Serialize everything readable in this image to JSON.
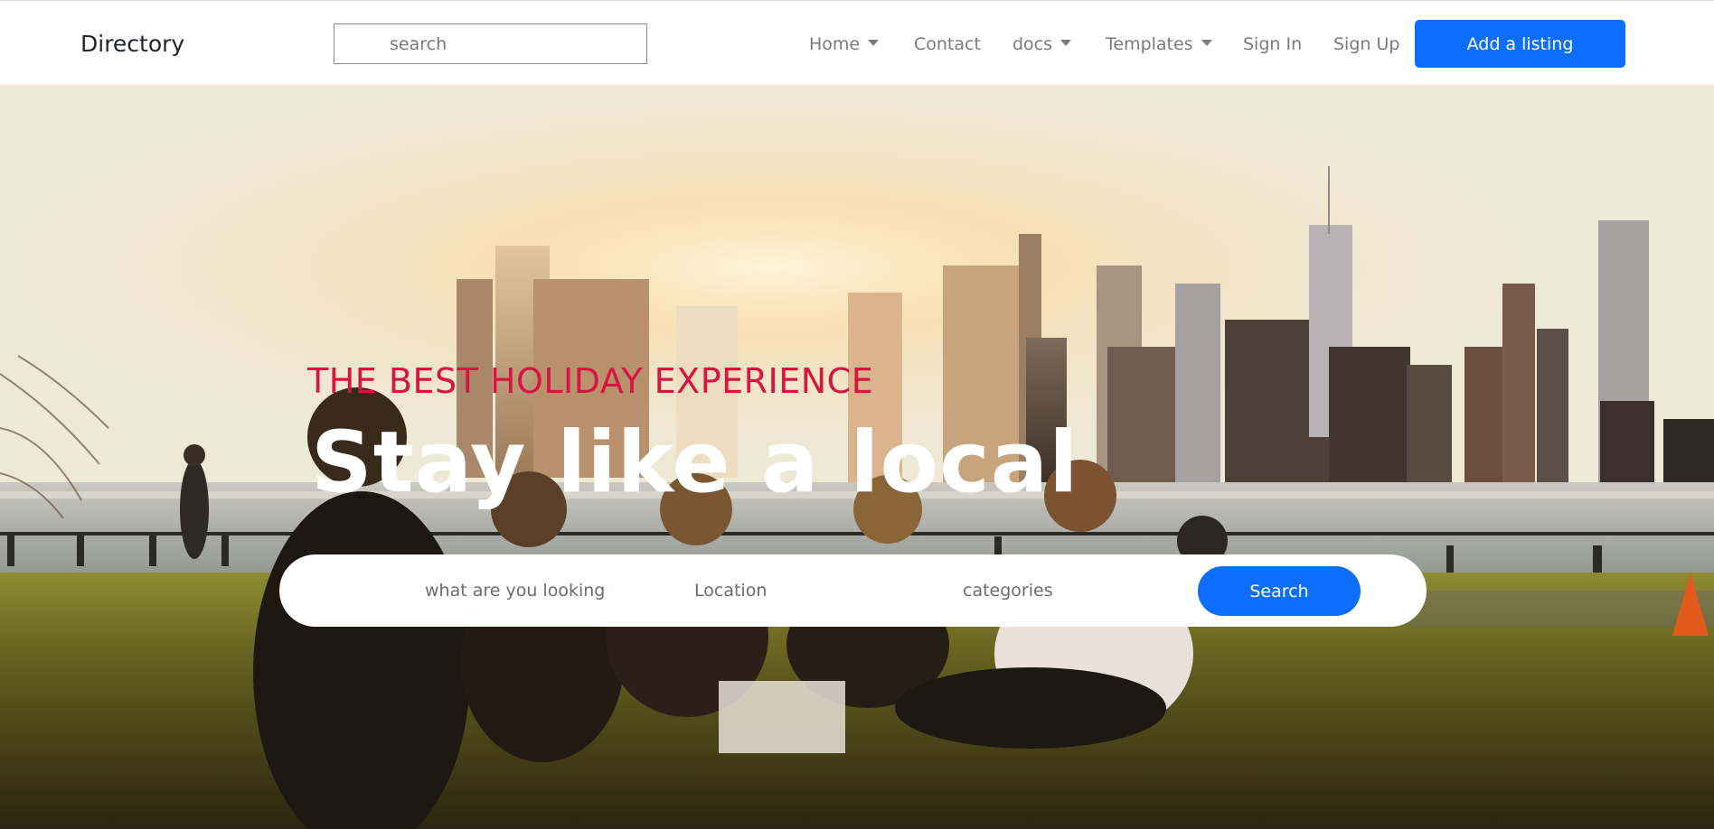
{
  "navbar": {
    "brand": "Directory",
    "search_placeholder": "search",
    "links": {
      "home": "Home",
      "contact": "Contact",
      "docs": "docs",
      "templates": "Templates",
      "sign_in": "Sign In",
      "sign_up": "Sign Up"
    },
    "add_listing": "Add a listing"
  },
  "hero": {
    "subtitle": "THE BEST HOLIDAY EXPERIENCE",
    "title": "Stay like a local",
    "search": {
      "what_placeholder": "what are you looking for",
      "location_placeholder": "Location",
      "categories_placeholder": "categories",
      "button": "Search"
    }
  },
  "colors": {
    "primary": "#0d6efd",
    "accent": "#d6163f",
    "nav_text": "#7b7b7b"
  },
  "icons": {
    "caret": "caret-down-icon"
  }
}
